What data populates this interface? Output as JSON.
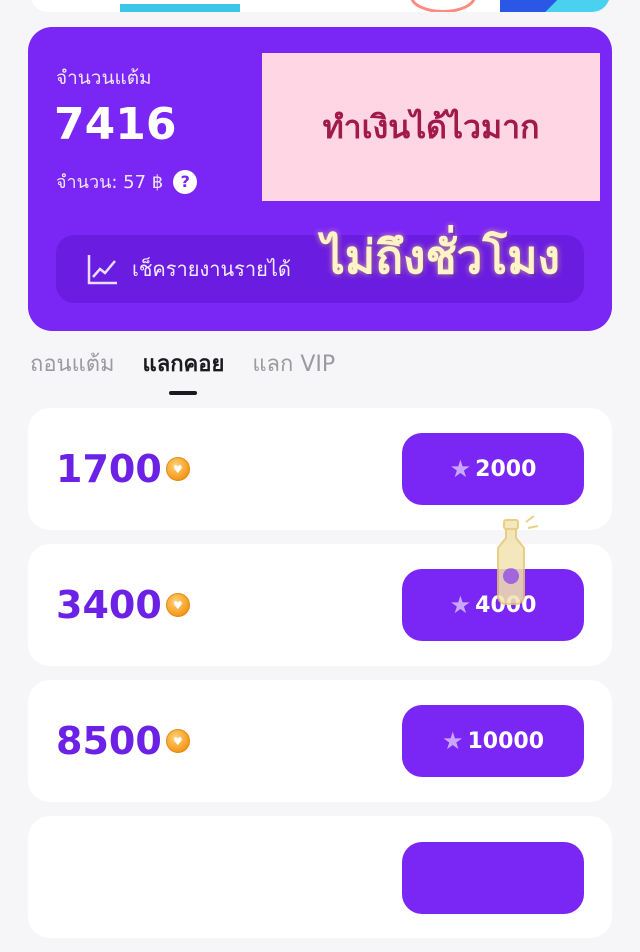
{
  "points_card": {
    "label": "จำนวนแต้ม",
    "value": "7416",
    "amount_label": "จำนวน: 57 ฿",
    "help": "?",
    "promo_text": "ทำเงินได้ไวมาก",
    "report_label": "เช็ครายงานรายได้",
    "overlay_text": "ไม่ถึงชั่วโมง"
  },
  "tabs": [
    {
      "label": "ถอนแต้ม",
      "active": false
    },
    {
      "label": "แลกคอย",
      "active": true
    },
    {
      "label": "แลก VIP",
      "active": false
    }
  ],
  "exchange_rows": [
    {
      "coins": "1700",
      "cost": "2000"
    },
    {
      "coins": "3400",
      "cost": "4000"
    },
    {
      "coins": "8500",
      "cost": "10000"
    }
  ],
  "colors": {
    "primary_purple": "#7a26f4",
    "coin_orange": "#f49b1b",
    "promo_pink_bg": "#ffd6e4"
  }
}
